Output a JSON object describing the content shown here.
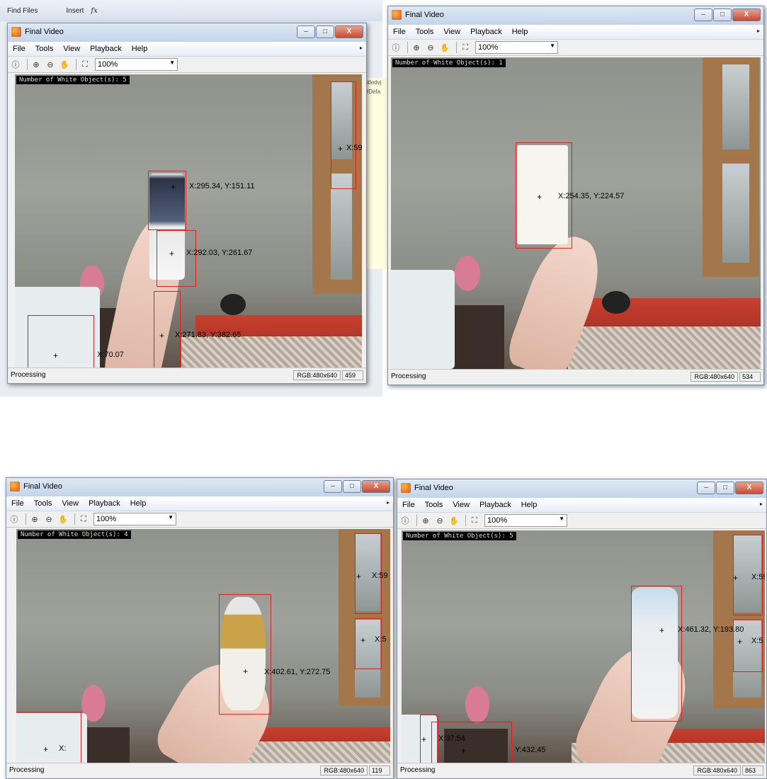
{
  "background_app": {
    "toolbar_items": [
      "Find Files",
      "Insert",
      "fx"
    ],
    "side_snippets": [
      "itledvj",
      "tDefa"
    ]
  },
  "windows": [
    {
      "title": "Final Video",
      "menu": [
        "File",
        "Tools",
        "View",
        "Playback",
        "Help"
      ],
      "zoom": "100%",
      "overlay": "Number of White Object(s):  5",
      "coords": [
        "X:295.34, Y:151.11",
        "X:292.03, Y:261.67",
        "X:271.83, Y:382.65",
        "X:70.07",
        "X:59"
      ],
      "status": "Processing",
      "dims": "RGB:480x640",
      "frame": "459"
    },
    {
      "title": "Final Video",
      "menu": [
        "File",
        "Tools",
        "View",
        "Playback",
        "Help"
      ],
      "zoom": "100%",
      "overlay": "Number of White Object(s):  1",
      "coords": [
        "X:254.35, Y:224.57"
      ],
      "status": "Processing",
      "dims": "RGB:480x640",
      "frame": "534"
    },
    {
      "title": "Final Video",
      "menu": [
        "File",
        "Tools",
        "View",
        "Playback",
        "Help"
      ],
      "zoom": "100%",
      "overlay": "Number of White Object(s):  4",
      "coords": [
        "X:402.61, Y:272.75",
        "X:59",
        "X:5",
        "X:"
      ],
      "status": "Processing",
      "dims": "RGB:480x640",
      "frame": "119"
    },
    {
      "title": "Final Video",
      "menu": [
        "File",
        "Tools",
        "View",
        "Playback",
        "Help"
      ],
      "zoom": "100%",
      "overlay": "Number of White Object(s):  5",
      "coords": [
        "X:461.32, Y:193.80",
        "X:37.54",
        "Y:432.45",
        "X:59",
        "X:5"
      ],
      "status": "Processing",
      "dims": "RGB:480x640",
      "frame": "863"
    }
  ],
  "window_buttons": {
    "minimize": "–",
    "maximize": "□",
    "close": "X"
  },
  "icons": [
    "info-icon",
    "zoom-in-icon",
    "zoom-out-icon",
    "pan-hand-icon",
    "fit-to-window-icon",
    "dropdown-arrow-icon"
  ],
  "colors": {
    "bbox": "#e02020",
    "overlay_bg": "#000000",
    "titlebar": "#c3d4ea"
  }
}
